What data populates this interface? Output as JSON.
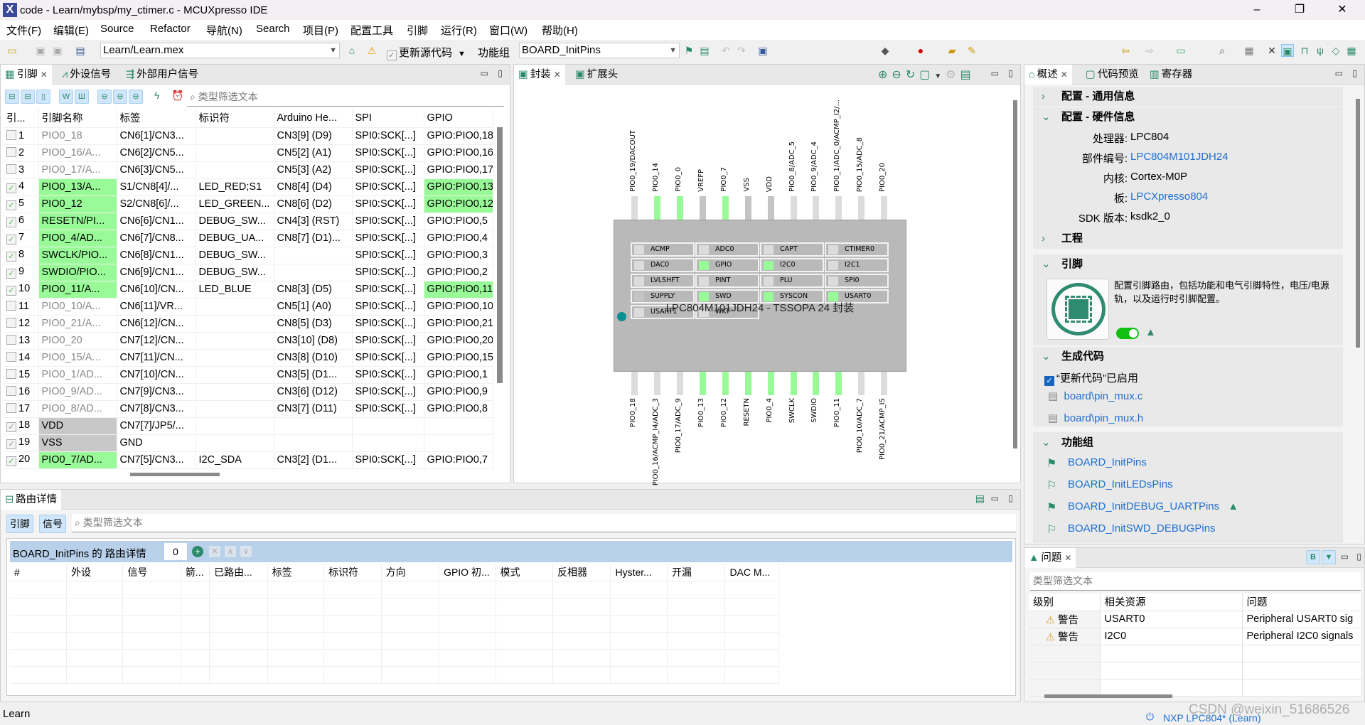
{
  "window": {
    "title": "code - Learn/mybsp/my_ctimer.c - MCUXpresso IDE",
    "minimize": "–",
    "restore": "❐",
    "close": "✕"
  },
  "menu": [
    "文件(F)",
    "编辑(E)",
    "Source",
    "Refactor",
    "导航(N)",
    "Search",
    "项目(P)",
    "配置工具",
    "引脚",
    "运行(R)",
    "窗口(W)",
    "帮助(H)"
  ],
  "toolbar": {
    "config_file": "Learn/Learn.mex",
    "update_code": "更新源代码",
    "function_group_label": "功能组",
    "function_group_value": "BOARD_InitPins"
  },
  "pins_view": {
    "tabs": [
      "引脚",
      "外设信号",
      "外部用户信号"
    ],
    "filter_placeholder": "类型筛选文本",
    "columns": [
      "引...",
      "引脚名称",
      "标签",
      "标识符",
      "Arduino He...",
      "SPI",
      "GPIO"
    ],
    "rows": [
      {
        "n": "1",
        "checked": false,
        "name": "PIO0_18",
        "name_state": "none",
        "label": "CN6[1]/CN3...",
        "id": "",
        "arduino": "CN3[9] (D9)",
        "spi": "SPI0:SCK[...]",
        "gpio": "GPIO:PIO0,18",
        "gpio_on": false
      },
      {
        "n": "2",
        "checked": false,
        "name": "PIO0_16/A...",
        "name_state": "none",
        "label": "CN6[2]/CN5...",
        "id": "",
        "arduino": "CN5[2] (A1)",
        "spi": "SPI0:SCK[...]",
        "gpio": "GPIO:PIO0,16",
        "gpio_on": false
      },
      {
        "n": "3",
        "checked": false,
        "name": "PIO0_17/A...",
        "name_state": "none",
        "label": "CN6[3]/CN5...",
        "id": "",
        "arduino": "CN5[3] (A2)",
        "spi": "SPI0:SCK[...]",
        "gpio": "GPIO:PIO0,17",
        "gpio_on": false
      },
      {
        "n": "4",
        "checked": true,
        "name": "PIO0_13/A...",
        "name_state": "routed",
        "label": "S1/CN8[4]/...",
        "id": "LED_RED;S1",
        "arduino": "CN8[4] (D4)",
        "spi": "SPI0:SCK[...]",
        "gpio": "GPIO:PIO0,13",
        "gpio_on": true
      },
      {
        "n": "5",
        "checked": true,
        "name": "PIO0_12",
        "name_state": "routed",
        "label": "S2/CN8[6]/...",
        "id": "LED_GREEN...",
        "arduino": "CN8[6] (D2)",
        "spi": "SPI0:SCK[...]",
        "gpio": "GPIO:PIO0,12",
        "gpio_on": true
      },
      {
        "n": "6",
        "checked": true,
        "name": "RESETN/PI...",
        "name_state": "routed",
        "label": "CN6[6]/CN1...",
        "id": "DEBUG_SW...",
        "arduino": "CN4[3] (RST)",
        "spi": "SPI0:SCK[...]",
        "gpio": "GPIO:PIO0,5",
        "gpio_on": false
      },
      {
        "n": "7",
        "checked": true,
        "name": "PIO0_4/AD...",
        "name_state": "routed",
        "label": "CN6[7]/CN8...",
        "id": "DEBUG_UA...",
        "arduino": "CN8[7] (D1)...",
        "spi": "SPI0:SCK[...]",
        "gpio": "GPIO:PIO0,4",
        "gpio_on": false
      },
      {
        "n": "8",
        "checked": true,
        "name": "SWCLK/PIO...",
        "name_state": "routed",
        "label": "CN6[8]/CN1...",
        "id": "DEBUG_SW...",
        "arduino": "",
        "spi": "SPI0:SCK[...]",
        "gpio": "GPIO:PIO0,3",
        "gpio_on": false
      },
      {
        "n": "9",
        "checked": true,
        "name": "SWDIO/PIO...",
        "name_state": "routed",
        "label": "CN6[9]/CN1...",
        "id": "DEBUG_SW...",
        "arduino": "",
        "spi": "SPI0:SCK[...]",
        "gpio": "GPIO:PIO0,2",
        "gpio_on": false
      },
      {
        "n": "10",
        "checked": true,
        "name": "PIO0_11/A...",
        "name_state": "routed",
        "label": "CN6[10]/CN...",
        "id": "LED_BLUE",
        "arduino": "CN8[3] (D5)",
        "spi": "SPI0:SCK[...]",
        "gpio": "GPIO:PIO0,11",
        "gpio_on": true
      },
      {
        "n": "11",
        "checked": false,
        "name": "PIO0_10/A...",
        "name_state": "none",
        "label": "CN6[11]/VR...",
        "id": "",
        "arduino": "CN5[1] (A0)",
        "spi": "SPI0:SCK[...]",
        "gpio": "GPIO:PIO0,10",
        "gpio_on": false
      },
      {
        "n": "12",
        "checked": false,
        "name": "PIO0_21/A...",
        "name_state": "none",
        "label": "CN6[12]/CN...",
        "id": "",
        "arduino": "CN8[5] (D3)",
        "spi": "SPI0:SCK[...]",
        "gpio": "GPIO:PIO0,21",
        "gpio_on": false
      },
      {
        "n": "13",
        "checked": false,
        "name": "PIO0_20",
        "name_state": "none",
        "label": "CN7[12]/CN...",
        "id": "",
        "arduino": "CN3[10] (D8)",
        "spi": "SPI0:SCK[...]",
        "gpio": "GPIO:PIO0,20",
        "gpio_on": false
      },
      {
        "n": "14",
        "checked": false,
        "name": "PIO0_15/A...",
        "name_state": "none",
        "label": "CN7[11]/CN...",
        "id": "",
        "arduino": "CN3[8] (D10)",
        "spi": "SPI0:SCK[...]",
        "gpio": "GPIO:PIO0,15",
        "gpio_on": false
      },
      {
        "n": "15",
        "checked": false,
        "name": "PIO0_1/AD...",
        "name_state": "none",
        "label": "CN7[10]/CN...",
        "id": "",
        "arduino": "CN3[5] (D1...",
        "spi": "SPI0:SCK[...]",
        "gpio": "GPIO:PIO0,1",
        "gpio_on": false
      },
      {
        "n": "16",
        "checked": false,
        "name": "PIO0_9/AD...",
        "name_state": "none",
        "label": "CN7[9]/CN3...",
        "id": "",
        "arduino": "CN3[6] (D12)",
        "spi": "SPI0:SCK[...]",
        "gpio": "GPIO:PIO0,9",
        "gpio_on": false
      },
      {
        "n": "17",
        "checked": false,
        "name": "PIO0_8/AD...",
        "name_state": "none",
        "label": "CN7[8]/CN3...",
        "id": "",
        "arduino": "CN3[7] (D11)",
        "spi": "SPI0:SCK[...]",
        "gpio": "GPIO:PIO0,8",
        "gpio_on": false
      },
      {
        "n": "18",
        "checked": true,
        "name": "VDD",
        "name_state": "power",
        "label": "CN7[7]/JP5/...",
        "id": "",
        "arduino": "",
        "spi": "",
        "gpio": "",
        "gpio_on": false
      },
      {
        "n": "19",
        "checked": true,
        "name": "VSS",
        "name_state": "power",
        "label": "GND",
        "id": "",
        "arduino": "",
        "spi": "",
        "gpio": "",
        "gpio_on": false
      },
      {
        "n": "20",
        "checked": true,
        "name": "PIO0_7/AD...",
        "name_state": "routed",
        "label": "CN7[5]/CN3...",
        "id": "I2C_SDA",
        "arduino": "CN3[2] (D1...",
        "spi": "SPI0:SCK[...]",
        "gpio": "GPIO:PIO0,7",
        "gpio_on": false
      }
    ]
  },
  "package_view": {
    "tabs": [
      "封装",
      "扩展头"
    ],
    "chip_title": "LPC804M101JDH24 - TSSOPA 24 封装",
    "top_pins": [
      {
        "label": "PIO0_19/DACOUT",
        "state": "free"
      },
      {
        "label": "PIO0_14",
        "state": "routed"
      },
      {
        "label": "PIO0_0",
        "state": "routed"
      },
      {
        "label": "VREFP",
        "state": "power"
      },
      {
        "label": "PIO0_7",
        "state": "routed"
      },
      {
        "label": "VSS",
        "state": "power"
      },
      {
        "label": "VDD",
        "state": "power"
      },
      {
        "label": "PIO0_8/ADC_5",
        "state": "free"
      },
      {
        "label": "PIO0_9/ADC_4",
        "state": "free"
      },
      {
        "label": "PIO0_1/ADC_0/ACMP_I2/...",
        "state": "free"
      },
      {
        "label": "PIO0_15/ADC_8",
        "state": "free"
      },
      {
        "label": "PIO0_20",
        "state": "free"
      }
    ],
    "bottom_pins": [
      {
        "label": "PIO0_18",
        "state": "free"
      },
      {
        "label": "PIO0_16/ACMP_I4/ADC_3",
        "state": "free"
      },
      {
        "label": "PIO0_17/ADC_9",
        "state": "free"
      },
      {
        "label": "PIO0_13",
        "state": "routed"
      },
      {
        "label": "PIO0_12",
        "state": "routed"
      },
      {
        "label": "RESETN",
        "state": "routed"
      },
      {
        "label": "PIO0_4",
        "state": "routed"
      },
      {
        "label": "SWCLK",
        "state": "routed"
      },
      {
        "label": "SWDIO",
        "state": "routed"
      },
      {
        "label": "PIO0_11",
        "state": "routed"
      },
      {
        "label": "PIO0_10/ADC_7",
        "state": "free"
      },
      {
        "label": "PIO0_21/ACMP_I5",
        "state": "free"
      }
    ],
    "peripherals": [
      {
        "name": "ACMP",
        "state": "free"
      },
      {
        "name": "ADC0",
        "state": "free"
      },
      {
        "name": "CAPT",
        "state": "free"
      },
      {
        "name": "CTIMER0",
        "state": "free"
      },
      {
        "name": "DAC0",
        "state": "free"
      },
      {
        "name": "GPIO",
        "state": "routed"
      },
      {
        "name": "I2C0",
        "state": "routed"
      },
      {
        "name": "I2C1",
        "state": "free"
      },
      {
        "name": "LVLSHFT",
        "state": "free"
      },
      {
        "name": "PINT",
        "state": "free"
      },
      {
        "name": "PLU",
        "state": "free"
      },
      {
        "name": "SPI0",
        "state": "free"
      },
      {
        "name": "SUPPLY",
        "state": "power"
      },
      {
        "name": "SWD",
        "state": "routed"
      },
      {
        "name": "SYSCON",
        "state": "routed"
      },
      {
        "name": "USART0",
        "state": "routed"
      },
      {
        "name": "USART1",
        "state": "free"
      },
      {
        "name": "WKT",
        "state": "free"
      }
    ],
    "colors": {
      "routed": "#99fb98",
      "free": "#dcdcdc",
      "power": "#c4c4c4"
    }
  },
  "overview": {
    "tabs": [
      "概述",
      "代码预览",
      "寄存器"
    ],
    "general_section": "配置 - 通用信息",
    "hardware_section": "配置 - 硬件信息",
    "hardware": [
      {
        "key": "处理器:",
        "value": "LPC804",
        "link": false
      },
      {
        "key": "部件编号:",
        "value": "LPC804M101JDH24",
        "link": true
      },
      {
        "key": "内核:",
        "value": "Cortex-M0P",
        "link": false
      },
      {
        "key": "板:",
        "value": "LPCXpresso804",
        "link": true
      },
      {
        "key": "SDK 版本:",
        "value": "ksdk2_0",
        "link": false
      }
    ],
    "project_section": "工程",
    "pins_section": "引脚",
    "pins_description": "配置引脚路由，包括功能和电气引脚特性，电压/电源轨，以及运行时引脚配置。",
    "pins_enabled": true,
    "codegen_section": "生成代码",
    "update_code_enabled": "“更新代码”已启用",
    "files": [
      "board\\pin_mux.c",
      "board\\pin_mux.h"
    ],
    "function_groups_section": "功能组",
    "function_groups": [
      {
        "name": "BOARD_InitPins",
        "active": true,
        "warning": false
      },
      {
        "name": "BOARD_InitLEDsPins",
        "active": false,
        "warning": false
      },
      {
        "name": "BOARD_InitDEBUG_UARTPins",
        "active": true,
        "warning": true
      },
      {
        "name": "BOARD_InitSWD_DEBUGPins",
        "active": false,
        "warning": false
      }
    ]
  },
  "routing": {
    "tab": "路由详情",
    "btn_pins": "引脚",
    "btn_signals": "信号",
    "filter_placeholder": "类型筛选文本",
    "header": "BOARD_InitPins 的 路由详情",
    "count": "0",
    "columns": [
      "#",
      "外设",
      "信号",
      "箭...",
      "已路由...",
      "标签",
      "标识符",
      "方向",
      "GPIO 初...",
      "模式",
      "反相器",
      "Hyster...",
      "开漏",
      "DAC M..."
    ]
  },
  "problems": {
    "tab": "问题",
    "filter_placeholder": "类型筛选文本",
    "columns": [
      "级别",
      "相关资源",
      "问题"
    ],
    "rows": [
      {
        "level": "警告",
        "resource": "USART0",
        "issue": "Peripheral USART0 sig"
      },
      {
        "level": "警告",
        "resource": "I2C0",
        "issue": "Peripheral I2C0 signals"
      }
    ]
  },
  "status": {
    "project": "Learn",
    "target": "NXP LPC804* (Learn)",
    "watermark": "CSDN @weixin_51686526"
  }
}
